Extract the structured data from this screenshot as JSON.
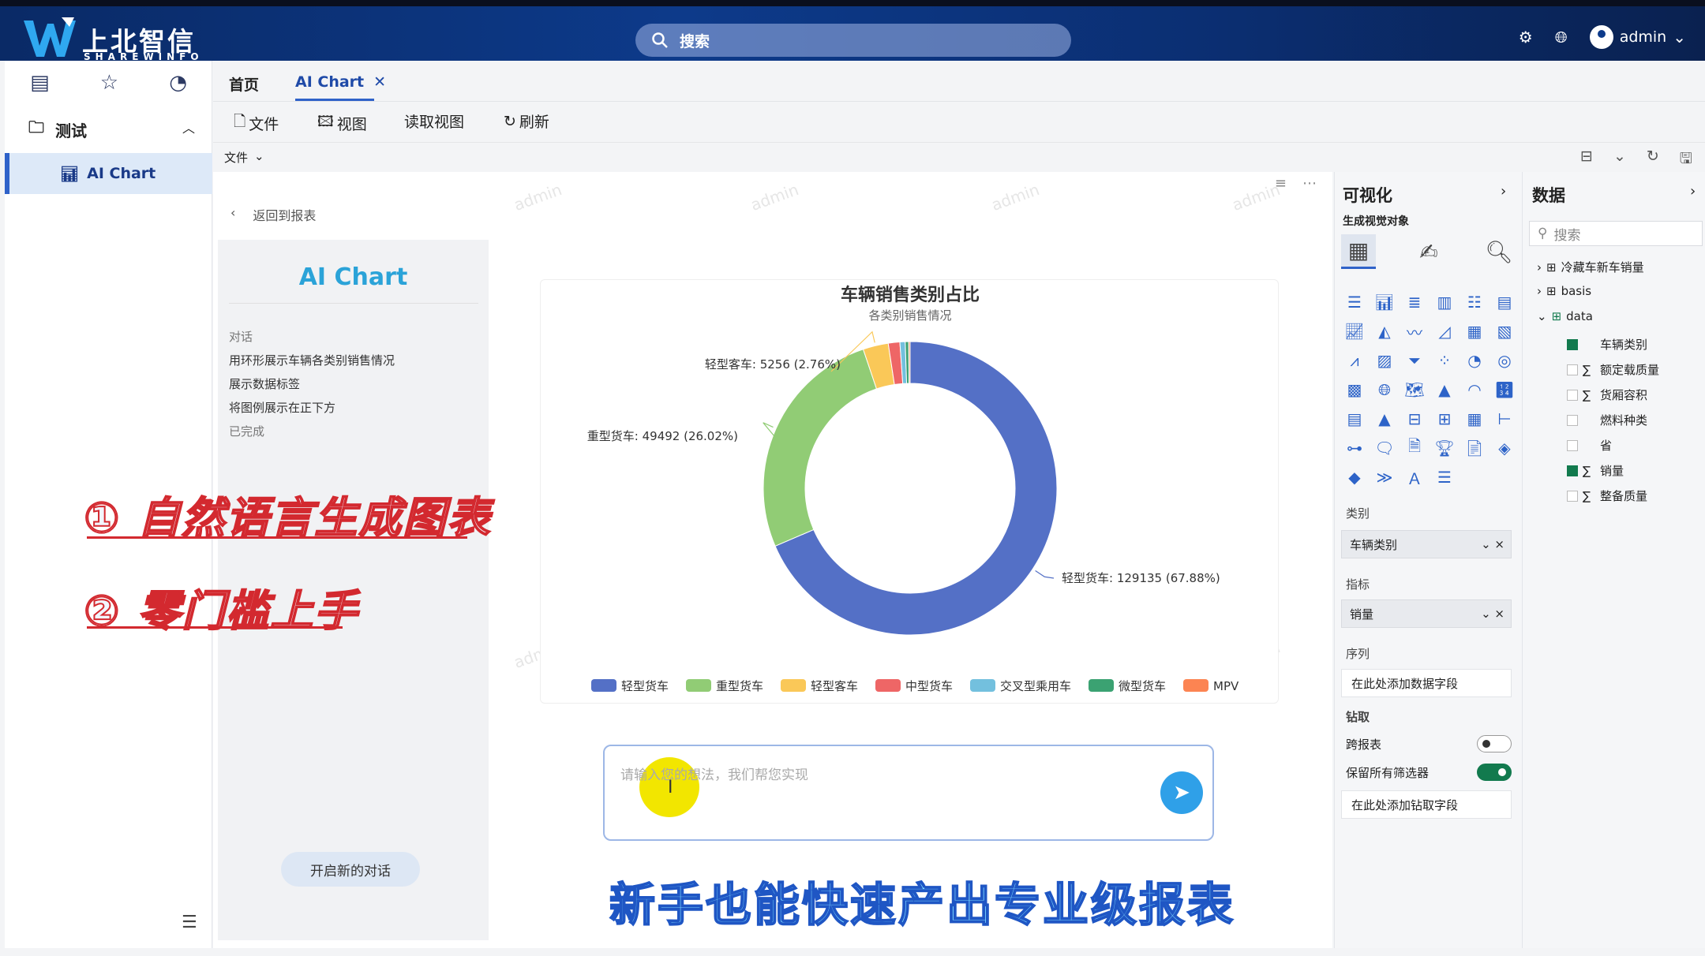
{
  "topbar": {
    "logo_text": "上北智信",
    "logo_sub": "SHAREWINFO",
    "search_placeholder": "搜索",
    "username": "admin"
  },
  "sidebar": {
    "folder_label": "测试",
    "items": [
      {
        "label": "AI Chart"
      }
    ]
  },
  "tabs": [
    {
      "label": "首页"
    },
    {
      "label": "AI Chart"
    }
  ],
  "menu": {
    "file": "文件",
    "view": "视图",
    "read_view": "读取视图",
    "refresh": "刷新",
    "file_dropdown": "文件"
  },
  "report": {
    "back_label": "返回到报表",
    "watermark": "admin",
    "chat": {
      "title": "AI Chart",
      "messages": [
        "对话",
        "用环形展示车辆各类别销售情况",
        "展示数据标签",
        "将图例展示在正下方",
        "已完成"
      ],
      "new_chat_label": "开启新的对话"
    },
    "input_placeholder": "请输入您的想法，我们帮您实现"
  },
  "chart_data": {
    "type": "pie",
    "variant": "donut",
    "title": "车辆销售类别占比",
    "subtitle": "各类别销售情况",
    "categories": [
      "轻型货车",
      "重型货车",
      "轻型客车",
      "中型货车",
      "交叉型乘用车",
      "微型货车",
      "MPV"
    ],
    "values": [
      129135,
      49492,
      5256,
      2400,
      1100,
      700,
      300
    ],
    "labels": [
      "轻型货车: 129135 (67.88%)",
      "重型货车: 49492 (26.02%)",
      "轻型客车: 5256 (2.76%)"
    ],
    "colors": [
      "#5470c6",
      "#91cc75",
      "#fac858",
      "#ee6666",
      "#73c0de",
      "#3ba272",
      "#fc8452"
    ],
    "legend_position": "bottom"
  },
  "overlay": {
    "caption1": "① 自然语言生成图表",
    "caption2": "② 零门槛上手",
    "subtitle": "新手也能快速产出专业级报表"
  },
  "viz": {
    "title": "可视化",
    "subtitle": "生成视觉对象",
    "category_label": "类别",
    "category_value": "车辆类别",
    "metric_label": "指标",
    "metric_value": "销量",
    "series_label": "序列",
    "series_add": "在此处添加数据字段",
    "drill_label": "钻取",
    "cross_report": "跨报表",
    "keep_filters": "保留所有筛选器",
    "drill_add": "在此处添加钻取字段"
  },
  "data": {
    "title": "数据",
    "search_placeholder": "搜索",
    "tables": [
      "冷藏车新车销量",
      "basis",
      "data"
    ],
    "fields": [
      {
        "name": "车辆类别",
        "checked": true,
        "sum": false
      },
      {
        "name": "额定载质量",
        "checked": false,
        "sum": true
      },
      {
        "name": "货厢容积",
        "checked": false,
        "sum": true
      },
      {
        "name": "燃料种类",
        "checked": false,
        "sum": false
      },
      {
        "name": "省",
        "checked": false,
        "sum": false
      },
      {
        "name": "销量",
        "checked": true,
        "sum": true
      },
      {
        "name": "整备质量",
        "checked": false,
        "sum": true
      }
    ]
  }
}
